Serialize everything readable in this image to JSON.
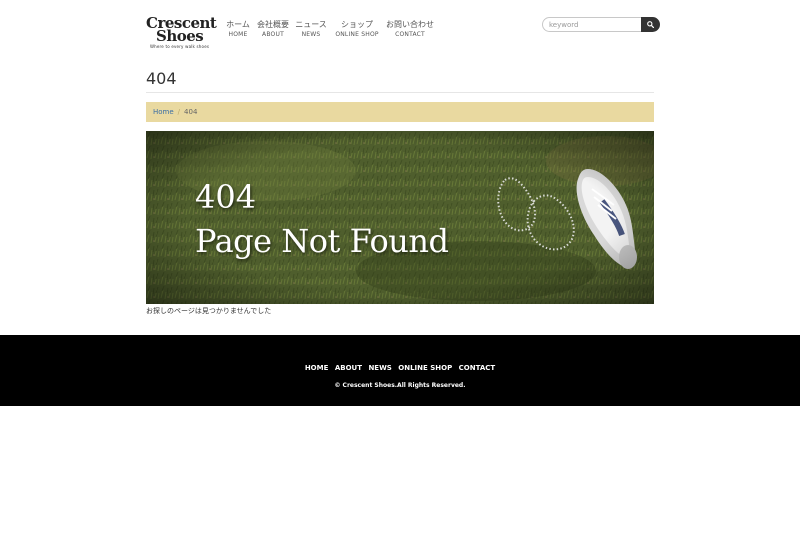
{
  "brand": {
    "logo_line1": "Crescent",
    "logo_line2": "Shoes",
    "tagline": "Where to every walk shoes"
  },
  "nav": [
    {
      "jp": "ホーム",
      "en": "HOME"
    },
    {
      "jp": "会社概要",
      "en": "ABOUT"
    },
    {
      "jp": "ニュース",
      "en": "NEWS"
    },
    {
      "jp": "ショップ",
      "en": "ONLINE SHOP"
    },
    {
      "jp": "お問い合わせ",
      "en": "CONTACT"
    }
  ],
  "search": {
    "placeholder": "keyword",
    "icon": "search-icon"
  },
  "page": {
    "title": "404"
  },
  "breadcrumb": {
    "home": "Home",
    "separator": "/",
    "current": "404"
  },
  "hero": {
    "line1": "404",
    "line2": "Page Not Found"
  },
  "message": "お探しのページは見つかりませんでした",
  "footer": {
    "links": [
      "HOME",
      "ABOUT",
      "NEWS",
      "ONLINE SHOP",
      "CONTACT"
    ],
    "copyright": "© Crescent Shoes.All Rights Reserved."
  },
  "colors": {
    "breadcrumb_bg": "#e9d9a0",
    "footer_bg": "#000000",
    "link": "#3a6ea5",
    "grass": "#4a5a2a"
  }
}
